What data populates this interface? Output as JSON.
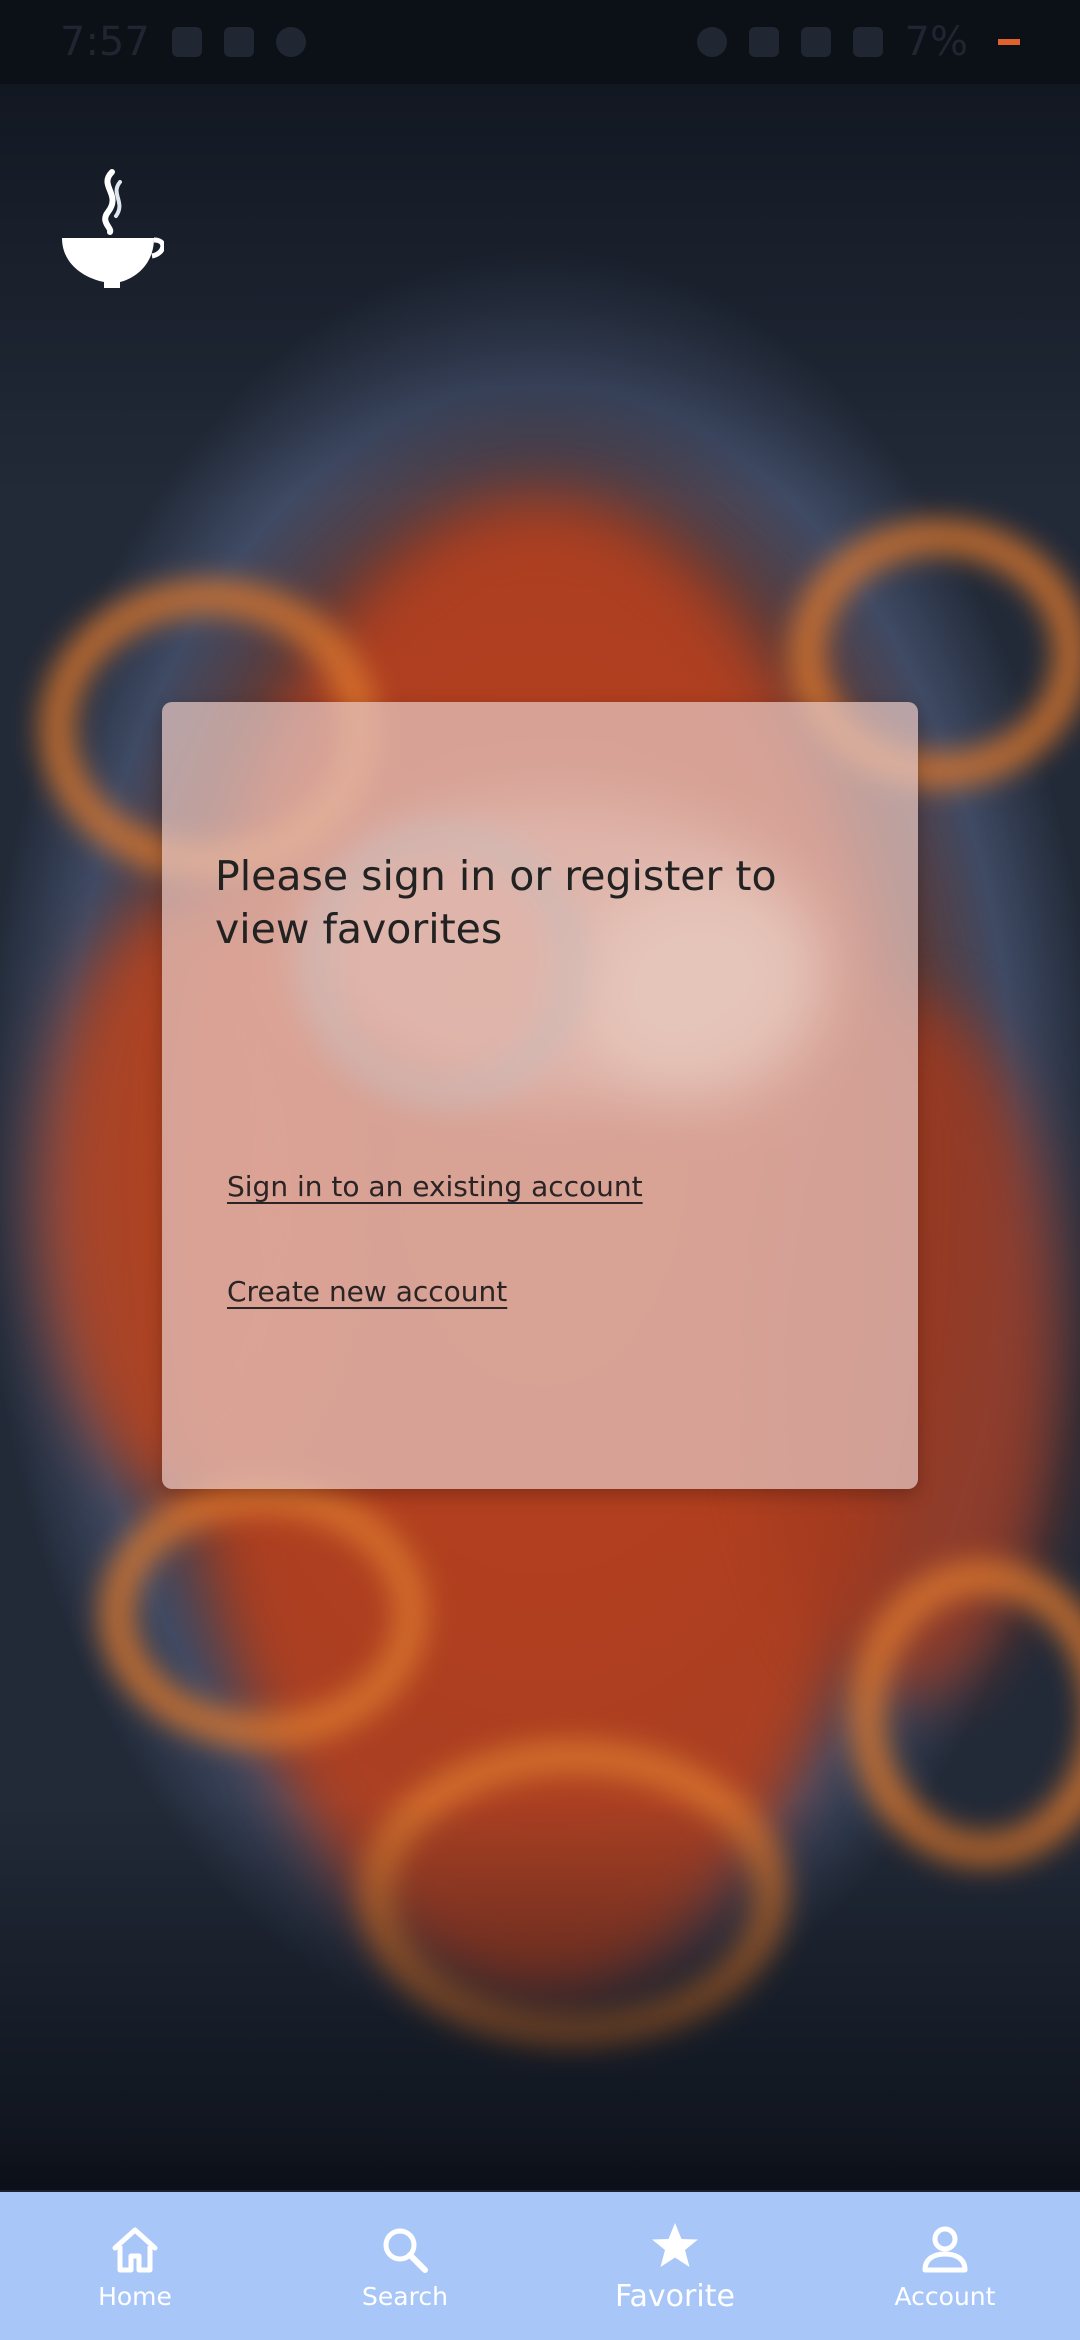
{
  "status_bar": {
    "time": "7:57",
    "battery": "7%"
  },
  "app": {
    "logo_icon": "steaming-bowl-icon"
  },
  "card": {
    "message": "Please sign in or register to view favorites",
    "sign_in_link": "Sign in to an existing account",
    "create_account_link": "Create new account"
  },
  "bottom_nav": {
    "active": "Favorite",
    "items": [
      {
        "label": "Home",
        "icon": "home-icon"
      },
      {
        "label": "Search",
        "icon": "search-icon"
      },
      {
        "label": "Favorite",
        "icon": "star-icon"
      },
      {
        "label": "Account",
        "icon": "person-icon"
      }
    ]
  },
  "colors": {
    "nav_background": "#a8c7f8",
    "card_background": "#e6c8c4",
    "battery_low": "#e0612c"
  }
}
